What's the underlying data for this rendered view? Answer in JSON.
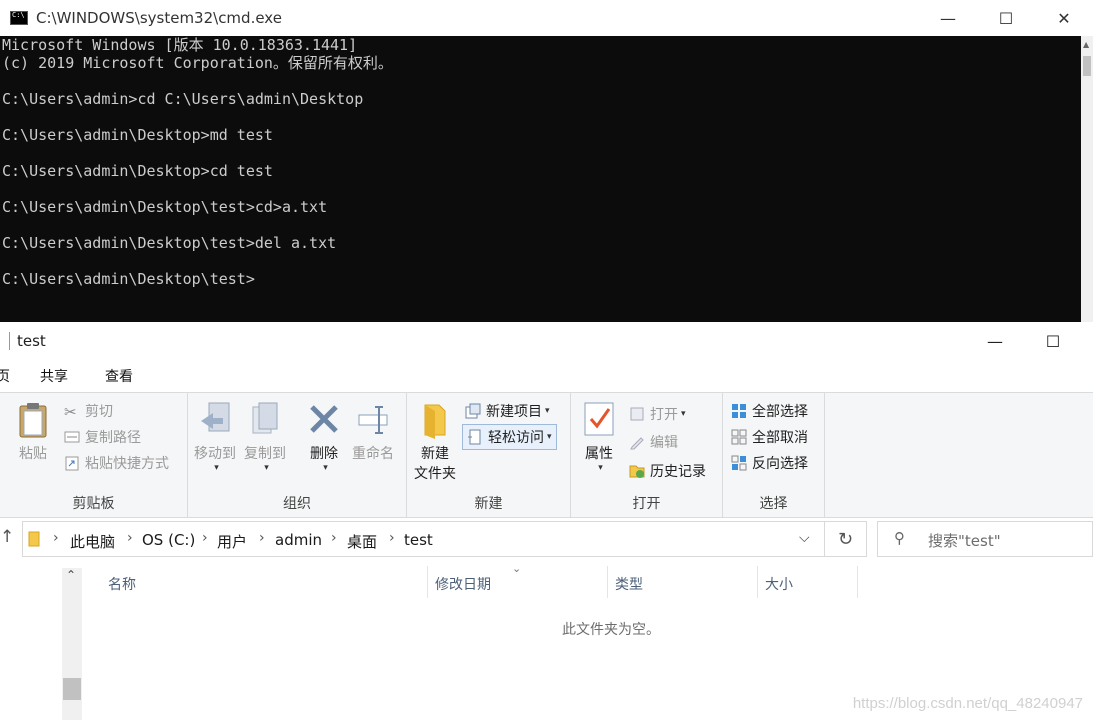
{
  "cmd": {
    "title": "C:\\WINDOWS\\system32\\cmd.exe",
    "lines": [
      "Microsoft Windows [版本 10.0.18363.1441]",
      "(c) 2019 Microsoft Corporation。保留所有权利。",
      "",
      "C:\\Users\\admin>cd C:\\Users\\admin\\Desktop",
      "",
      "C:\\Users\\admin\\Desktop>md test",
      "",
      "C:\\Users\\admin\\Desktop>cd test",
      "",
      "C:\\Users\\admin\\Desktop\\test>cd>a.txt",
      "",
      "C:\\Users\\admin\\Desktop\\test>del a.txt",
      "",
      "C:\\Users\\admin\\Desktop\\test>"
    ],
    "colors": {
      "background": "#0c0c0c",
      "text": "#cccccc"
    }
  },
  "explorer": {
    "title": "test",
    "tabs": {
      "file": "页",
      "share": "共享",
      "view": "查看"
    },
    "ribbon": {
      "clipboard": {
        "label": "剪贴板",
        "paste": "粘贴",
        "cut": "剪切",
        "copy_path": "复制路径",
        "paste_shortcut": "粘贴快捷方式"
      },
      "organize": {
        "label": "组织",
        "move_to": "移动到",
        "copy_to": "复制到",
        "delete": "删除",
        "rename": "重命名"
      },
      "new": {
        "label": "新建",
        "new_folder_line1": "新建",
        "new_folder_line2": "文件夹",
        "new_item": "新建项目",
        "easy_access": "轻松访问"
      },
      "open": {
        "label": "打开",
        "properties": "属性",
        "open": "打开",
        "edit": "编辑",
        "history": "历史记录"
      },
      "select": {
        "label": "选择",
        "select_all": "全部选择",
        "select_none": "全部取消",
        "invert": "反向选择"
      }
    },
    "address": {
      "crumbs": [
        "此电脑",
        "OS (C:)",
        "用户",
        "admin",
        "桌面",
        "test"
      ],
      "search_placeholder": "搜索\"test\""
    },
    "columns": {
      "name": "名称",
      "modified": "修改日期",
      "type": "类型",
      "size": "大小"
    },
    "empty_message": "此文件夹为空。",
    "watermark": "https://blog.csdn.net/qq_48240947"
  }
}
